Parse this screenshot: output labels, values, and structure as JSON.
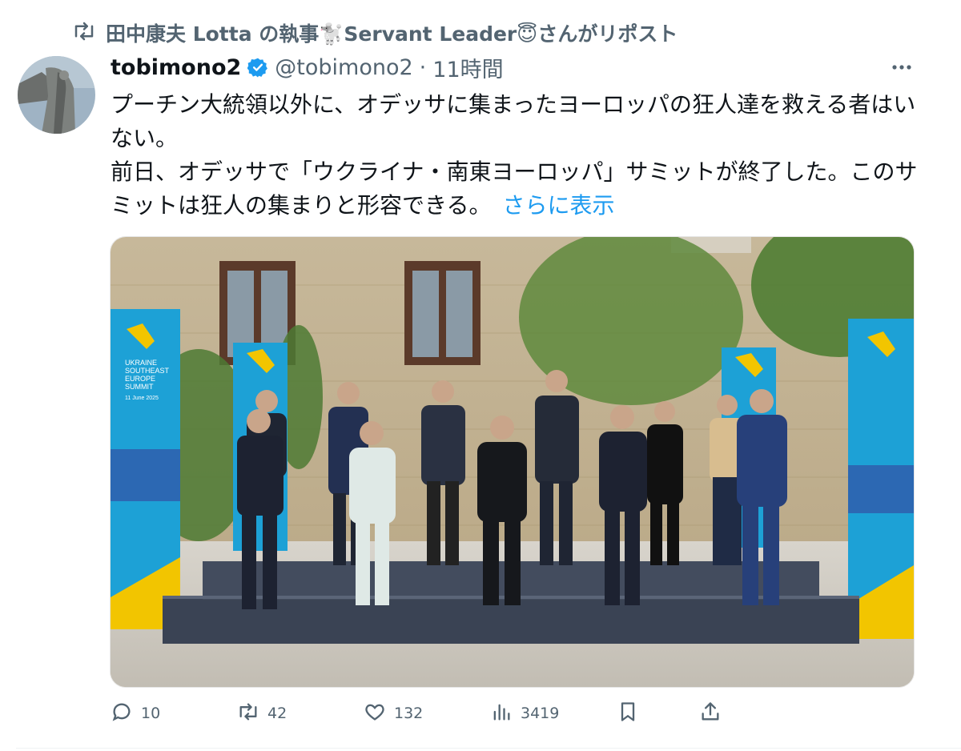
{
  "repost": {
    "icon": "repost-icon",
    "label": "田中康夫 Lotta の執事🐩Servant Leader😇さんがリポスト"
  },
  "post": {
    "author_name": "tobimono2",
    "verified_icon": "verified-badge-icon",
    "handle": "@tobimono2",
    "separator": "·",
    "time": "11時間",
    "more_icon": "more-options-icon",
    "paragraphs": [
      "プーチン大統領以外に、オデッサに集まったヨーロッパの狂人達を救える者はいない。",
      "前日、オデッサで「ウクライナ・南東ヨーロッパ」サミットが終了した。このサミットは狂人の集まりと形容できる。"
    ],
    "show_more": "さらに表示",
    "media_type": "photo",
    "banner_lines": [
      "UKRAINE",
      "SOUTHEAST",
      "EUROPE",
      "SUMMIT"
    ],
    "banner_date": "11 June 2025"
  },
  "actions": {
    "reply_count": "10",
    "repost_count": "42",
    "like_count": "132",
    "view_count": "3419"
  },
  "colors": {
    "accent": "#1d9bf0",
    "secondary_text": "#536471",
    "primary_text": "#0f1419"
  }
}
